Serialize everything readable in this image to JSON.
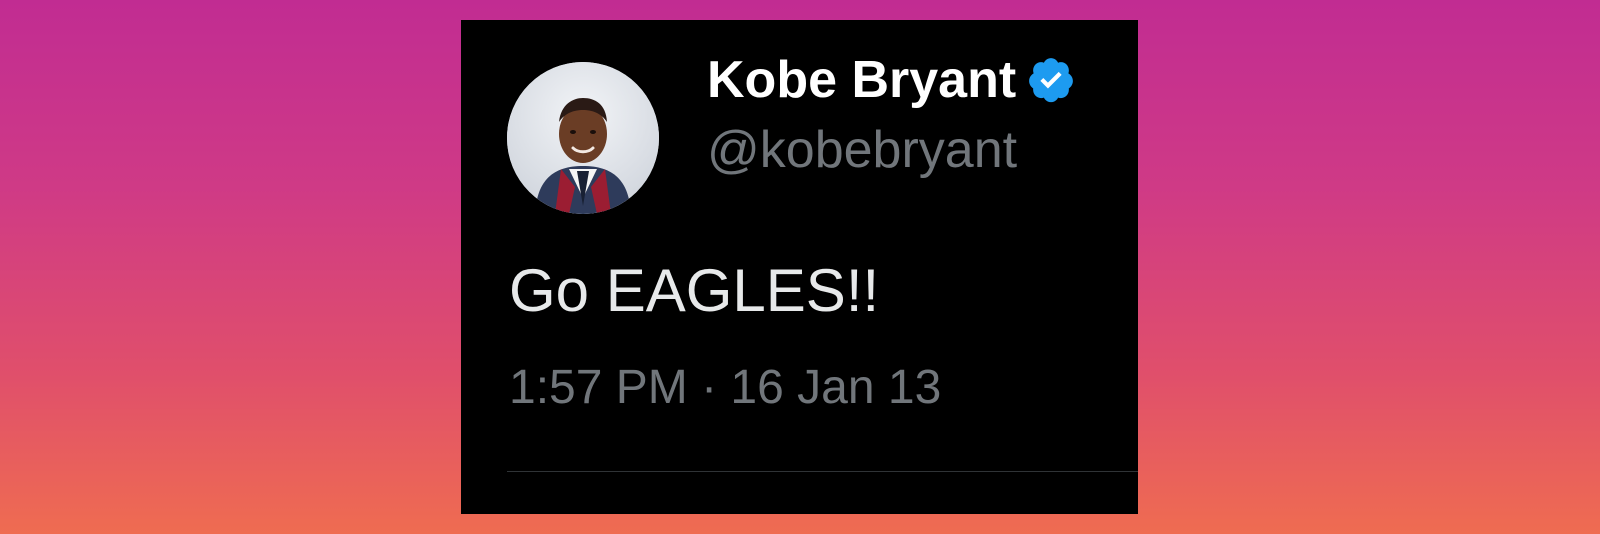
{
  "tweet": {
    "display_name": "Kobe Bryant",
    "handle": "@kobebryant",
    "text": "Go EAGLES!!",
    "timestamp": "1:57 PM · 16 Jan 13",
    "verified": true,
    "avatar_icon": "profile-photo",
    "verified_icon": "verified-badge-icon"
  },
  "colors": {
    "background_top": "#c12c92",
    "background_bottom": "#ef6c51",
    "card_background": "#000000",
    "name_text": "#ffffff",
    "body_text": "#e7e9ea",
    "secondary_text": "#71767b",
    "verified_blue": "#1d9bf0",
    "divider": "#2f3336"
  }
}
